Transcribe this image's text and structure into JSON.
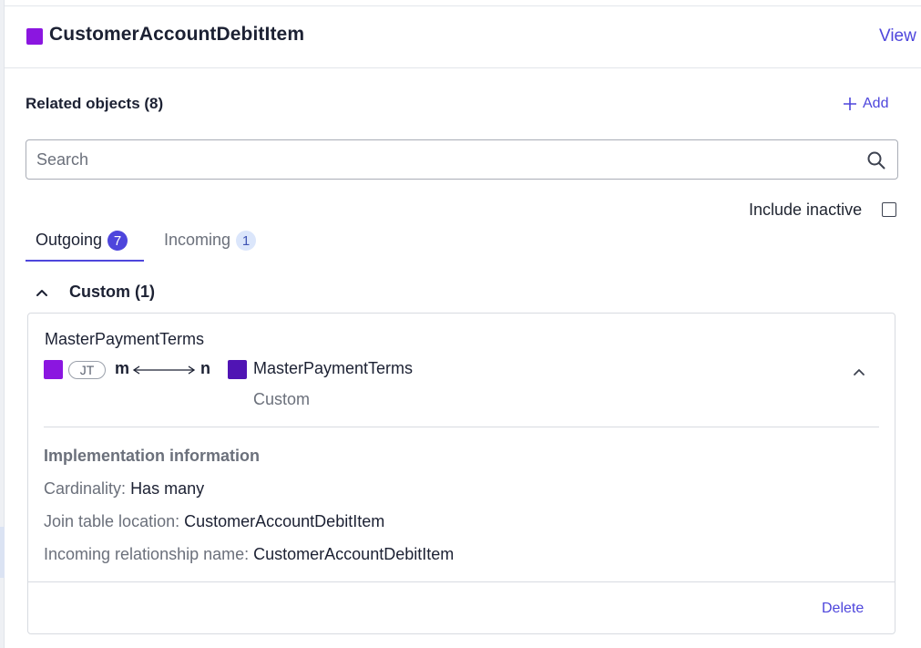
{
  "colors": {
    "accent": "#4e46dc",
    "object_square": "#8b16e0",
    "target_square": "#5014b4"
  },
  "header": {
    "title": "CustomerAccountDebitItem",
    "view_link": "View"
  },
  "related": {
    "title": "Related objects (8)",
    "add_label": "Add",
    "search_placeholder": "Search",
    "include_inactive_label": "Include inactive",
    "include_inactive_checked": false
  },
  "tabs": [
    {
      "label": "Outgoing",
      "count": "7",
      "active": true
    },
    {
      "label": "Incoming",
      "count": "1",
      "active": false
    }
  ],
  "group": {
    "title": "Custom (1)",
    "expanded": true
  },
  "card": {
    "title": "MasterPaymentTerms",
    "join_badge": "JT",
    "cardinality_from": "m",
    "cardinality_to": "n",
    "target_name": "MasterPaymentTerms",
    "target_type": "Custom",
    "impl_title": "Implementation information",
    "impl": [
      {
        "label": "Cardinality:",
        "value": "Has many"
      },
      {
        "label": "Join table location:",
        "value": "CustomerAccountDebitItem"
      },
      {
        "label": "Incoming relationship name:",
        "value": "CustomerAccountDebitItem"
      }
    ],
    "delete_label": "Delete"
  }
}
